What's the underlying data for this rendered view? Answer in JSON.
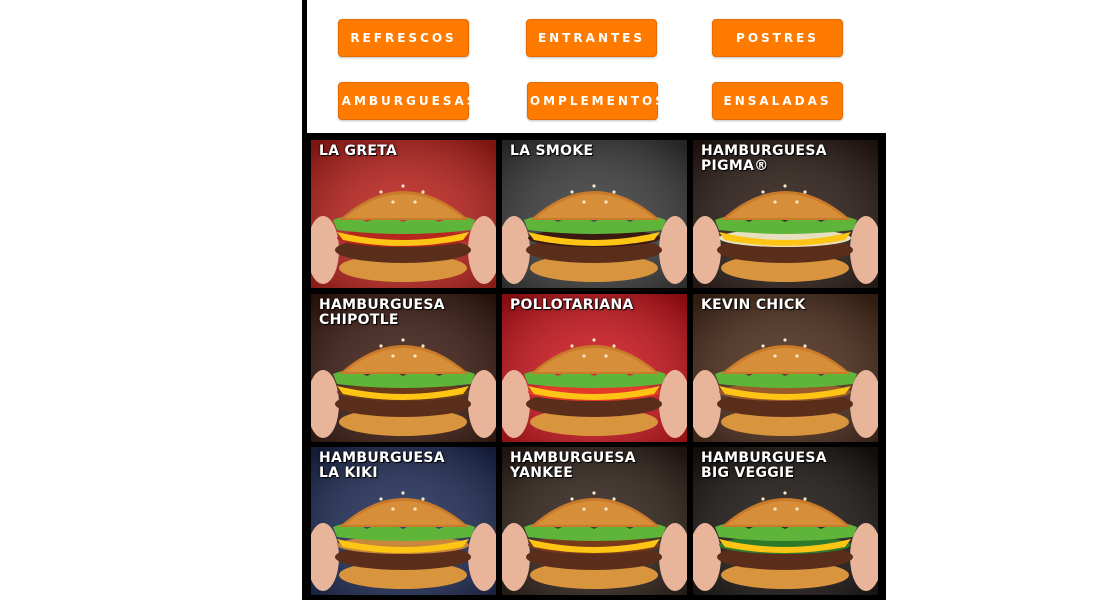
{
  "categories": [
    {
      "label": "REFRESCOS"
    },
    {
      "label": "ENTRANTES"
    },
    {
      "label": "POSTRES"
    },
    {
      "label": "HAMBURGUESAS"
    },
    {
      "label": "COMPLEMENTOS"
    },
    {
      "label": "ENSALADAS"
    }
  ],
  "menu_items": [
    {
      "title": "LA GRETA",
      "bg": "#c0201a"
    },
    {
      "title": "LA SMOKE",
      "bg": "#3a3a3a"
    },
    {
      "title": "HAMBURGUESA\nPIGMA®",
      "bg": "#2a1a14"
    },
    {
      "title": "HAMBURGUESA\nCHIPOTLE",
      "bg": "#3b1a10"
    },
    {
      "title": "POLLOTARIANA",
      "bg": "#d0121a"
    },
    {
      "title": "KEVIN CHICK",
      "bg": "#4a2a18"
    },
    {
      "title": "HAMBURGUESA\nLA KIKI",
      "bg": "#1d2a55"
    },
    {
      "title": "HAMBURGUESA\nYANKEE",
      "bg": "#2f2018"
    },
    {
      "title": "HAMBURGUESA\nBIG VEGGIE",
      "bg": "#1a1410"
    }
  ],
  "colors": {
    "accent": "#ff7b00",
    "frame": "#000000"
  }
}
